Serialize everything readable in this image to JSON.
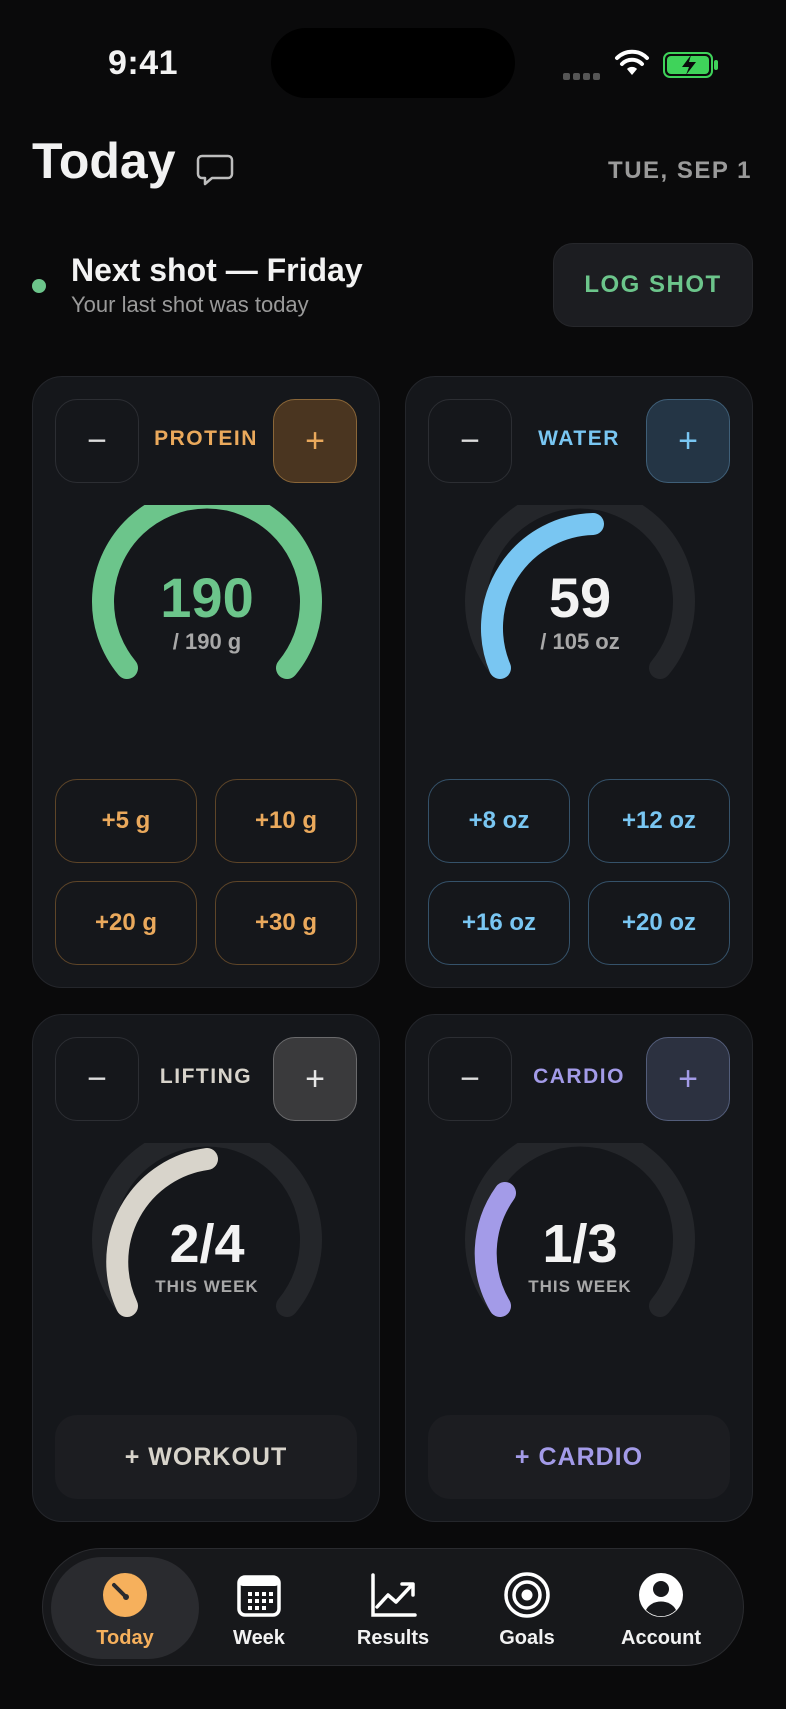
{
  "status_bar": {
    "time": "9:41"
  },
  "header": {
    "title": "Today",
    "date": "TUE, SEP 1"
  },
  "next_shot": {
    "title": "Next shot — Friday",
    "subtitle": "Your last shot was today",
    "button_label": "LOG SHOT"
  },
  "colors": {
    "protein": "#eaa95c",
    "water": "#79c6f2",
    "lifting": "#d8d4cb",
    "cardio": "#a39be8",
    "protein_ring": "#6cc58b",
    "shot_dot": "#6cc58b"
  },
  "cards": {
    "protein": {
      "label": "PROTEIN",
      "minus": "−",
      "plus": "+",
      "value": "190",
      "goal_text": "/ 190 g",
      "progress": 1.0,
      "quick_adds": [
        "+5 g",
        "+10 g",
        "+20 g",
        "+30 g"
      ]
    },
    "water": {
      "label": "WATER",
      "minus": "−",
      "plus": "+",
      "value": "59",
      "goal_text": "/ 105 oz",
      "progress": 0.562,
      "quick_adds": [
        "+8 oz",
        "+12 oz",
        "+16 oz",
        "+20 oz"
      ]
    },
    "lifting": {
      "label": "LIFTING",
      "minus": "−",
      "plus": "+",
      "value": "2/4",
      "sub_text": "THIS WEEK",
      "progress": 0.5,
      "button_label": "+ WORKOUT"
    },
    "cardio": {
      "label": "CARDIO",
      "minus": "−",
      "plus": "+",
      "value": "1/3",
      "sub_text": "THIS WEEK",
      "progress": 0.333,
      "button_label": "+ CARDIO"
    }
  },
  "tabs": [
    {
      "label": "Today",
      "icon": "gauge-icon",
      "active": true
    },
    {
      "label": "Week",
      "icon": "calendar-icon",
      "active": false
    },
    {
      "label": "Results",
      "icon": "trend-chart-icon",
      "active": false
    },
    {
      "label": "Goals",
      "icon": "target-icon",
      "active": false
    },
    {
      "label": "Account",
      "icon": "person-icon",
      "active": false
    }
  ]
}
